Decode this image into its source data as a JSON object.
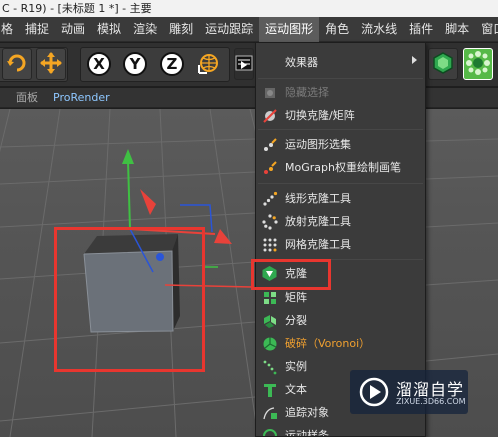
{
  "window": {
    "title": "C - R19) - [未标题 1 *] - 主要"
  },
  "menubar": {
    "items": [
      {
        "label": "格",
        "active": false
      },
      {
        "label": "捕捉",
        "active": false
      },
      {
        "label": "动画",
        "active": false
      },
      {
        "label": "模拟",
        "active": false
      },
      {
        "label": "渲染",
        "active": false
      },
      {
        "label": "雕刻",
        "active": false
      },
      {
        "label": "运动跟踪",
        "active": false
      },
      {
        "label": "运动图形",
        "active": true
      },
      {
        "label": "角色",
        "active": false
      },
      {
        "label": "流水线",
        "active": false
      },
      {
        "label": "插件",
        "active": false
      },
      {
        "label": "脚本",
        "active": false
      },
      {
        "label": "窗口",
        "active": false
      }
    ]
  },
  "toolbar": {
    "axis_x": "X",
    "axis_y": "Y",
    "axis_z": "Z",
    "icons": [
      "rotate-icon",
      "move-icon",
      "world-coordinates-icon",
      "render-view-icon",
      "mograph-cloner-icon",
      "mograph-fracture-icon"
    ]
  },
  "subbar": {
    "panel_label": "面板",
    "prorender_label": "ProRender"
  },
  "menu": {
    "effectors_label": "效果器",
    "hide_selection_label": "隐藏选择",
    "toggle_clone_label": "切换克隆/矩阵",
    "mograph_selection_label": "运动图形选集",
    "weight_paint_label": "MoGraph权重绘制画笔",
    "linear_clone_label": "线形克隆工具",
    "radial_clone_label": "放射克隆工具",
    "grid_clone_label": "网格克隆工具",
    "cloner_label": "克隆",
    "matrix_label": "矩阵",
    "fracture_label": "分裂",
    "voronoi_label": "破碎（Voronoi）",
    "instance_label": "实例",
    "text_label": "文本",
    "tracer_label": "追踪对象",
    "spline_label": "运动样条"
  },
  "watermark": {
    "title": "溜溜自学",
    "url": "ZIXUE.3D66.COM"
  },
  "colors": {
    "menu_active": "#5c5c5c",
    "highlight_red": "#e8362f",
    "voronoi_orange": "#f0a030",
    "axis_red": "#e8423a",
    "axis_green": "#3fc043",
    "axis_blue": "#2a55d8"
  }
}
